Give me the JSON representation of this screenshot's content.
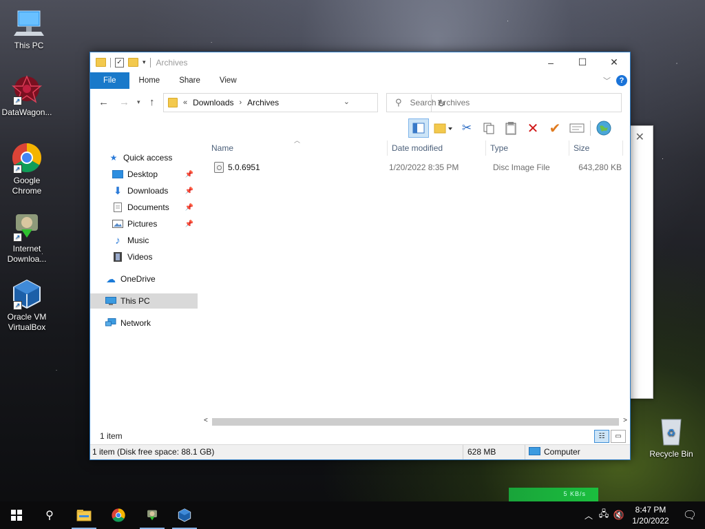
{
  "desktop": {
    "icons": [
      {
        "label": "This PC"
      },
      {
        "label": "DataWagon..."
      },
      {
        "label": "Google Chrome"
      },
      {
        "label": "Internet Downloa..."
      },
      {
        "label": "Oracle VM VirtualBox"
      },
      {
        "label": "Recycle Bin"
      }
    ]
  },
  "window": {
    "title": "Archives",
    "tabs": [
      "File",
      "Home",
      "Share",
      "View"
    ],
    "help_label": "?",
    "address": {
      "overflow": "«",
      "crumbs": [
        "Downloads",
        "Archives"
      ]
    },
    "search": {
      "placeholder": "Search Archives"
    },
    "nav": {
      "quick_access": "Quick access",
      "desktop": "Desktop",
      "downloads": "Downloads",
      "documents": "Documents",
      "pictures": "Pictures",
      "music": "Music",
      "videos": "Videos",
      "onedrive": "OneDrive",
      "this_pc": "This PC",
      "network": "Network"
    },
    "columns": [
      "Name",
      "Date modified",
      "Type",
      "Size"
    ],
    "files": [
      {
        "name": "5.0.6951",
        "date": "1/20/2022 8:35 PM",
        "type": "Disc Image File",
        "size": "643,280 KB"
      }
    ],
    "item_count": "1 item",
    "status": {
      "free": "1 item (Disk free space: 88.1 GB)",
      "size": "628 MB",
      "location": "Computer"
    }
  },
  "taskbar": {
    "time": "8:47 PM",
    "date": "1/20/2022",
    "netspeed": "5 KB/s"
  },
  "colors": {
    "accent": "#1979ca",
    "selected": "#d9d9d9"
  }
}
